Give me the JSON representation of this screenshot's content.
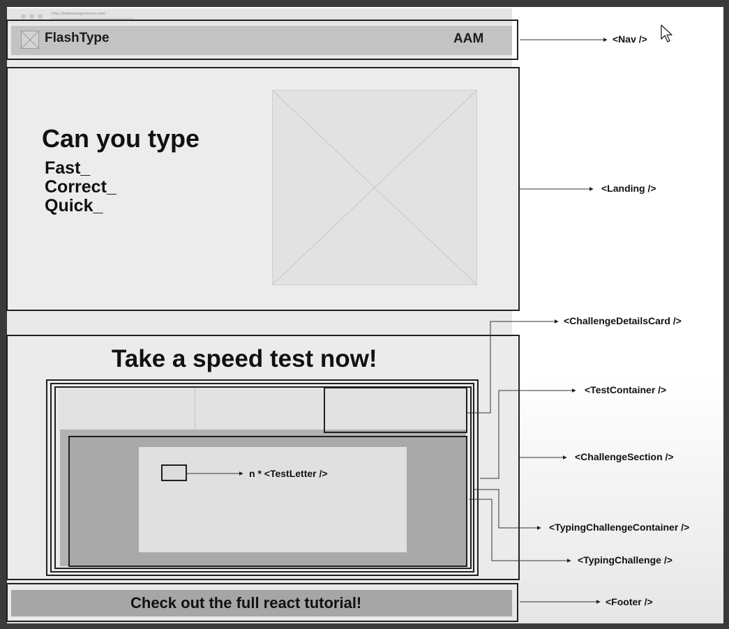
{
  "browser": {
    "url": "http://thebeezergrammar.com/"
  },
  "nav": {
    "brand": "FlashType",
    "initials": "AAM"
  },
  "landing": {
    "headline": "Can you type",
    "words": [
      "Fast_",
      "Correct_",
      "Quick_"
    ]
  },
  "challenge_section": {
    "title": "Take a speed test now!"
  },
  "typing_challenge": {
    "letter_label": "n * <TestLetter />"
  },
  "footer": {
    "text": "Check out the full react tutorial!"
  },
  "annotations": {
    "nav": "<Nav />",
    "landing": "<Landing />",
    "challenge_details_card": "<ChallengeDetailsCard />",
    "test_container": "<TestContainer />",
    "challenge_section": "<ChallengeSection />",
    "typing_challenge_container": "<TypingChallengeContainer />",
    "typing_challenge": "<TypingChallenge />",
    "footer": "<Footer />"
  }
}
